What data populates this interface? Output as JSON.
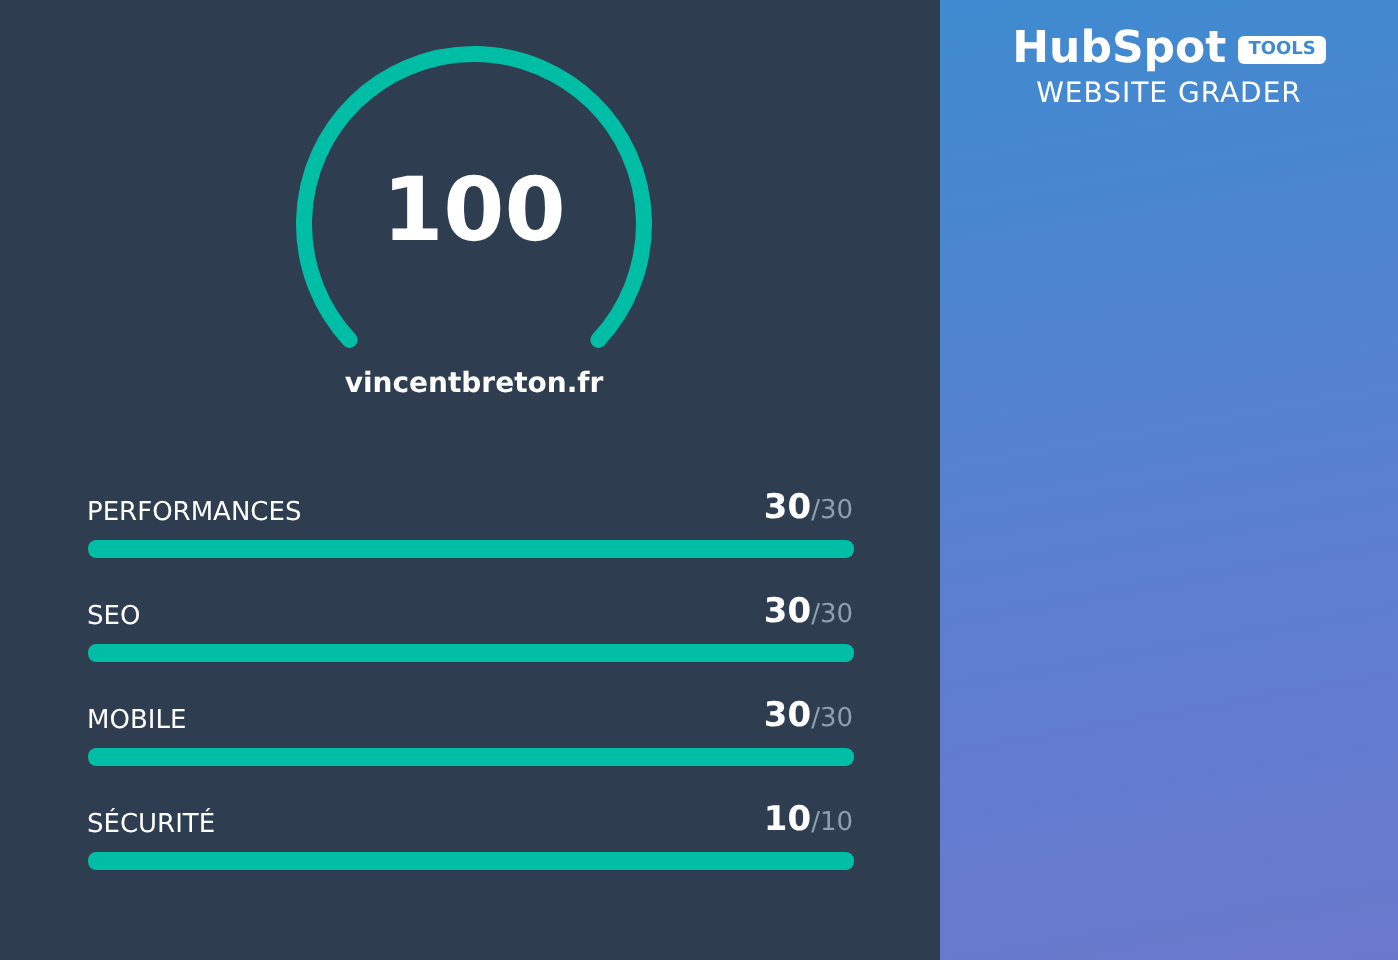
{
  "score": {
    "value": "100",
    "site": "vincentbreton.fr"
  },
  "metrics": [
    {
      "name": "PERFORMANCES",
      "score": "30",
      "max": "/30",
      "level": 1
    },
    {
      "name": "SEO",
      "score": "30",
      "max": "/30",
      "level": 1
    },
    {
      "name": "MOBILE",
      "score": "30",
      "max": "/30",
      "level": 1
    },
    {
      "name": "SÉCURITÉ",
      "score": "10",
      "max": "/10",
      "level": 1
    }
  ],
  "brand": {
    "logo": "HubSpot",
    "badge": "TOOLS",
    "subtitle": "WEBSITE GRADER"
  }
}
